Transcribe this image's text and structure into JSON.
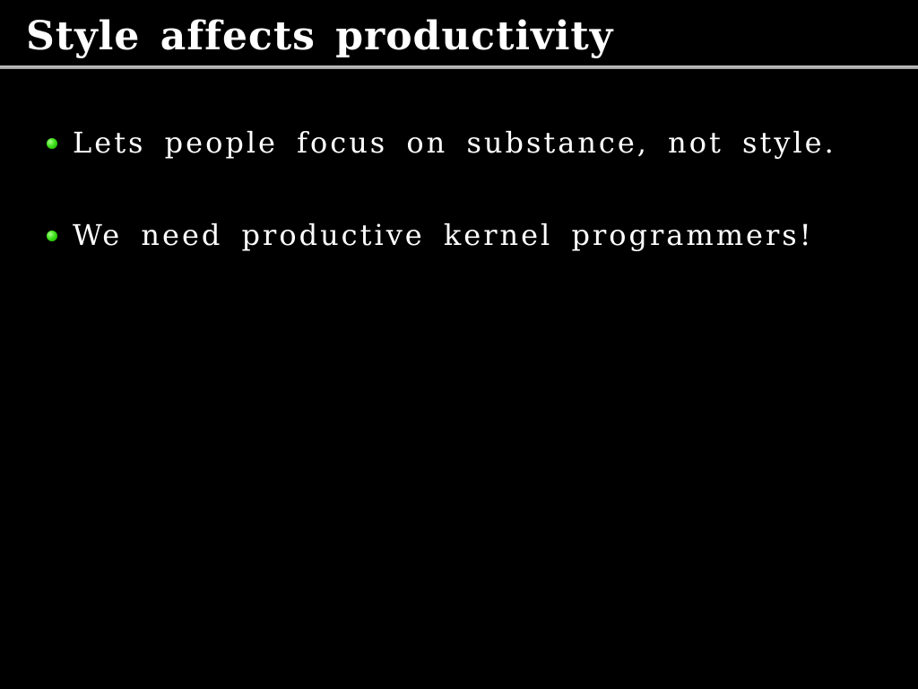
{
  "slide": {
    "title": "Style affects productivity",
    "bullets": [
      {
        "text": "Lets people focus on substance, not style."
      },
      {
        "text": "We need productive kernel programmers!"
      }
    ]
  },
  "colors": {
    "background": "#000000",
    "text": "#ffffff",
    "bullet": "#3ee01a",
    "rule": "#b4b4b4"
  },
  "icons": {
    "bullet": "green-dot-icon"
  }
}
